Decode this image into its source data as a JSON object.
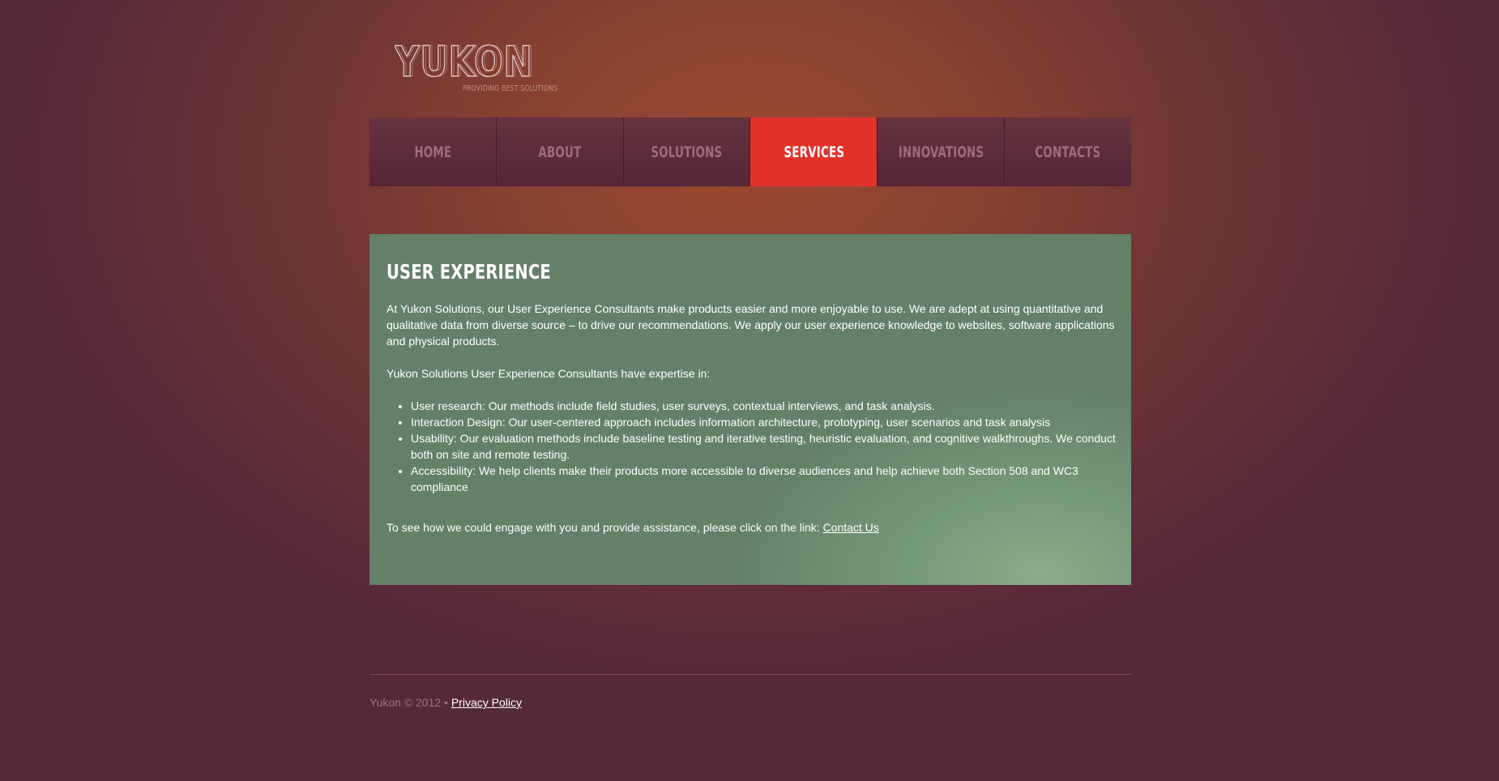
{
  "brand": {
    "name": "YUKON",
    "tagline": "PROVIDING BEST SOLUTIONS"
  },
  "nav": {
    "items": [
      {
        "label": "HOME"
      },
      {
        "label": "ABOUT"
      },
      {
        "label": "SOLUTIONS"
      },
      {
        "label": "SERVICES",
        "active": true
      },
      {
        "label": "INNOVATIONS"
      },
      {
        "label": "CONTACTS"
      }
    ]
  },
  "content": {
    "title": "USER EXPERIENCE",
    "intro": "At Yukon Solutions, our User Experience Consultants make products easier and more enjoyable to use. We are adept at using quantitative and qualitative data from diverse source – to drive our recommendations. We apply our user experience knowledge to websites, software applications and physical products.",
    "expertise_heading": "Yukon Solutions User Experience Consultants have expertise in:",
    "expertise": [
      "User research: Our methods include field studies, user surveys, contextual interviews, and task analysis.",
      "Interaction Design: Our user-centered approach includes information architecture, prototyping, user scenarios and task analysis",
      "Usability: Our evaluation methods include baseline testing and iterative testing, heuristic evaluation, and cognitive walkthroughs. We conduct both on site and remote testing.",
      "Accessibility: We help clients make their products more accessible to diverse audiences and help achieve both Section 508 and WC3 compliance"
    ],
    "cta_text": "To see how we could engage with you and provide assistance, please click on the link: ",
    "cta_link": "Contact Us"
  },
  "footer": {
    "copyright": "Yukon © 2012 • ",
    "privacy_link": "Privacy Policy"
  },
  "colors": {
    "active_nav": "#e2312a",
    "content_bg": "#648069",
    "nav_bg": "#5e2c3b"
  }
}
